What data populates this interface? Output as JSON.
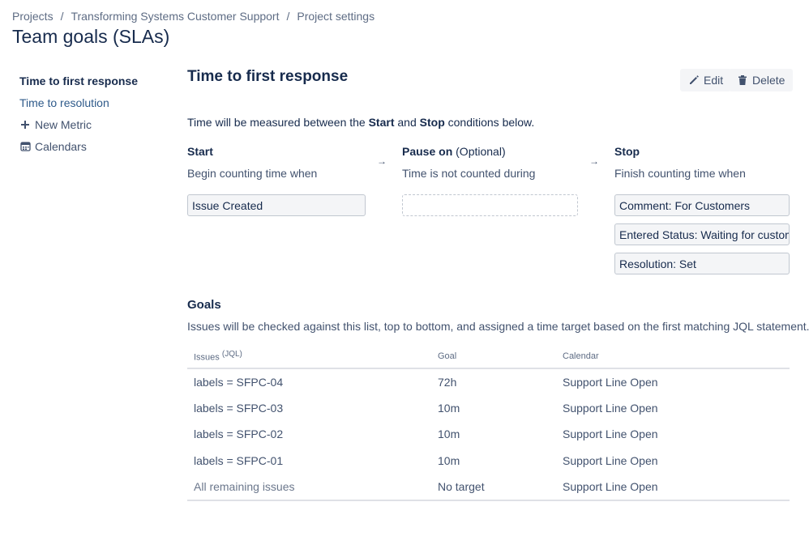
{
  "breadcrumb": {
    "items": [
      "Projects",
      "Transforming Systems Customer Support",
      "Project settings"
    ],
    "separator": "/"
  },
  "page_title": "Team goals (SLAs)",
  "sidebar": {
    "items": [
      {
        "label": "Time to first response"
      },
      {
        "label": "Time to resolution"
      },
      {
        "label": "New Metric",
        "icon": "plus-icon"
      },
      {
        "label": "Calendars",
        "icon": "calendar-icon"
      }
    ]
  },
  "metric": {
    "title": "Time to first response",
    "edit_label": "Edit",
    "delete_label": "Delete",
    "intro_prefix": "Time will be measured between the",
    "intro_start": "Start",
    "intro_and": "and",
    "intro_stop": "Stop",
    "intro_suffix": "conditions below.",
    "start": {
      "heading": "Start",
      "subtext": "Begin counting time when",
      "conditions": [
        "Issue Created"
      ]
    },
    "pause": {
      "heading": "Pause on",
      "optional": "(Optional)",
      "subtext": "Time is not counted during",
      "conditions": []
    },
    "stop": {
      "heading": "Stop",
      "subtext": "Finish counting time when",
      "conditions": [
        "Comment: For Customers",
        "Entered Status: Waiting for customer",
        "Resolution: Set"
      ]
    },
    "arrow": "→"
  },
  "goals": {
    "title": "Goals",
    "description": "Issues will be checked against this list, top to bottom, and assigned a time target based on the first matching JQL statement.",
    "columns": {
      "issues": "Issues",
      "issues_sup": "(JQL)",
      "goal": "Goal",
      "calendar": "Calendar"
    },
    "rows": [
      {
        "issues": "labels = SFPC-04",
        "goal": "72h",
        "calendar": "Support Line Open"
      },
      {
        "issues": "labels = SFPC-03",
        "goal": "10m",
        "calendar": "Support Line Open"
      },
      {
        "issues": "labels = SFPC-02",
        "goal": "10m",
        "calendar": "Support Line Open"
      },
      {
        "issues": "labels = SFPC-01",
        "goal": "10m",
        "calendar": "Support Line Open"
      },
      {
        "issues": "All remaining issues",
        "goal": "No target",
        "calendar": "Support Line Open"
      }
    ]
  }
}
